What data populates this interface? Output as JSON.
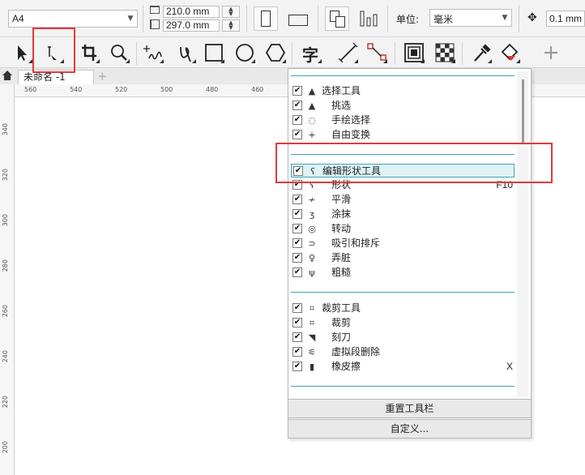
{
  "property_bar": {
    "page_size": "A4",
    "width_value": "210.0 mm",
    "height_value": "297.0 mm",
    "units_label": "单位:",
    "units_value": "毫米",
    "nudge_value": "0.1 mm"
  },
  "toolbox": {
    "tools": [
      {
        "name": "pick-tool",
        "icon": "arrow-icon"
      },
      {
        "name": "shape-tool",
        "icon": "shape-node-icon"
      },
      {
        "name": "crop-tool",
        "icon": "crop-icon"
      },
      {
        "name": "zoom-tool",
        "icon": "magnifier-icon"
      },
      {
        "name": "freehand-tool",
        "icon": "freehand-icon"
      },
      {
        "name": "artistic-media-tool",
        "icon": "curve-icon"
      },
      {
        "name": "rectangle-tool",
        "icon": "rectangle-icon"
      },
      {
        "name": "ellipse-tool",
        "icon": "ellipse-icon"
      },
      {
        "name": "polygon-tool",
        "icon": "polygon-icon"
      },
      {
        "name": "text-tool",
        "icon": "text-icon",
        "glyph": "字"
      },
      {
        "name": "dimension-tool",
        "icon": "line-icon"
      },
      {
        "name": "connector-tool",
        "icon": "connector-icon"
      },
      {
        "name": "shadow-tool",
        "icon": "shadow-icon"
      },
      {
        "name": "transparency-tool",
        "icon": "checker-icon"
      },
      {
        "name": "eyedropper-tool",
        "icon": "eyedropper-icon"
      },
      {
        "name": "fill-tool",
        "icon": "fill-bucket-icon"
      },
      {
        "name": "add-tool",
        "icon": "plus-icon"
      }
    ]
  },
  "document_tab": {
    "label": "未命名 -1"
  },
  "ruler": {
    "horizontal": [
      "560",
      "540",
      "520",
      "500",
      "480",
      "460"
    ],
    "vertical": [
      "340",
      "320",
      "300",
      "280",
      "260",
      "240",
      "220",
      "200"
    ]
  },
  "menu": {
    "groups": [
      {
        "items": [
          {
            "label": "选择工具",
            "checked": "✔",
            "icon": "arrow-icon",
            "glyph": "▲",
            "indent": false
          },
          {
            "label": "挑选",
            "checked": "✔",
            "icon": "arrow-icon",
            "glyph": "▲",
            "indent": true
          },
          {
            "label": "手绘选择",
            "checked": "✔",
            "icon": "freehand-select-icon",
            "glyph": "◌",
            "indent": true
          },
          {
            "label": "自由变换",
            "checked": "✔",
            "icon": "free-transform-icon",
            "glyph": "+",
            "indent": true
          }
        ]
      },
      {
        "items": [
          {
            "label": "编辑形状工具",
            "checked": "✔",
            "icon": "shape-node-icon",
            "glyph": "ʕ",
            "indent": false,
            "highlighted": true
          },
          {
            "label": "形状",
            "checked": "✔",
            "icon": "shape-node-icon",
            "glyph": "ʕ",
            "indent": true,
            "shortcut": "F10"
          },
          {
            "label": "平滑",
            "checked": "✔",
            "icon": "smooth-icon",
            "glyph": "≁",
            "indent": true
          },
          {
            "label": "涂抹",
            "checked": "✔",
            "icon": "smear-icon",
            "glyph": "ʒ",
            "indent": true
          },
          {
            "label": "转动",
            "checked": "✔",
            "icon": "twirl-icon",
            "glyph": "◎",
            "indent": true
          },
          {
            "label": "吸引和排斥",
            "checked": "✔",
            "icon": "attract-icon",
            "glyph": "⊃",
            "indent": true
          },
          {
            "label": "弄脏",
            "checked": "✔",
            "icon": "smudge-icon",
            "glyph": "♀",
            "indent": true
          },
          {
            "label": "粗糙",
            "checked": "✔",
            "icon": "roughen-icon",
            "glyph": "ψ",
            "indent": true
          }
        ]
      },
      {
        "items": [
          {
            "label": "裁剪工具",
            "checked": "✔",
            "icon": "crop-icon",
            "glyph": "⌗",
            "indent": false
          },
          {
            "label": "裁剪",
            "checked": "✔",
            "icon": "crop-icon",
            "glyph": "⌗",
            "indent": true
          },
          {
            "label": "刻刀",
            "checked": "✔",
            "icon": "knife-icon",
            "glyph": "◥",
            "indent": true
          },
          {
            "label": "虚拟段删除",
            "checked": "✔",
            "icon": "virtual-segment-delete-icon",
            "glyph": "⚟",
            "indent": true
          },
          {
            "label": "橡皮擦",
            "checked": "✔",
            "icon": "eraser-icon",
            "glyph": "▮",
            "indent": true,
            "shortcut": "X"
          }
        ]
      }
    ],
    "buttons": {
      "reset": "重置工具栏",
      "customize": "自定义..."
    }
  },
  "colors": {
    "accent": "#3aa5b8",
    "highlight_box": "#e5393b"
  }
}
